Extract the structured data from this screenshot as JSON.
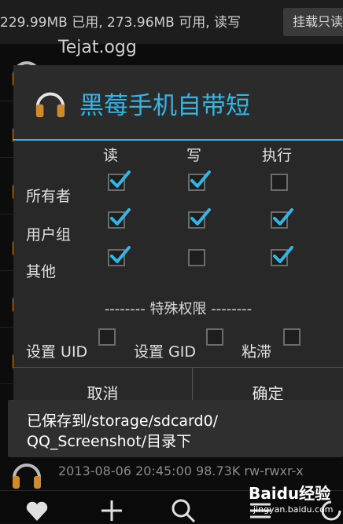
{
  "storage": {
    "text": "229.99MB 已用, 273.96MB 可用, 读写",
    "mount_button": "挂载只读"
  },
  "files": [
    {
      "name": "Tejat.ogg",
      "meta": ""
    },
    {
      "name": "",
      "meta": ""
    },
    {
      "name": "",
      "meta": ""
    },
    {
      "name": "",
      "meta": ""
    },
    {
      "name": "",
      "meta": ""
    },
    {
      "name": "",
      "meta": ""
    },
    {
      "name": "",
      "meta": ""
    }
  ],
  "bottom_file": {
    "meta": "2013-08-06 20:45:00  98.73K  rw-rwxr-x"
  },
  "dialog": {
    "title": "黑莓手机自带短",
    "columns": [
      "读",
      "写",
      "执行"
    ],
    "rows": [
      {
        "label": "所有者",
        "checks": [
          true,
          true,
          false
        ]
      },
      {
        "label": "用户组",
        "checks": [
          true,
          true,
          true
        ]
      },
      {
        "label": "其他",
        "checks": [
          true,
          false,
          true
        ]
      }
    ],
    "special_header": "-------- 特殊权限 --------",
    "special": [
      {
        "label": "设置 UID",
        "checked": false
      },
      {
        "label": "设置 GID",
        "checked": false
      },
      {
        "label": "粘滞",
        "checked": false
      }
    ],
    "cancel": "取消",
    "ok": "确定"
  },
  "toast": {
    "line1": "已保存到/storage/sdcard0/",
    "line2": "QQ_Screenshot/目录下"
  },
  "nav": {
    "icons": [
      "heart-icon",
      "plus-icon",
      "search-icon",
      "menu-icon",
      "refresh-icon"
    ]
  },
  "watermark": {
    "brand": "Baidu经验",
    "url": "jingyan.baidu.com"
  },
  "colors": {
    "accent": "#33b5e5",
    "background": "#0c0c0c",
    "dialog": "#282828"
  }
}
